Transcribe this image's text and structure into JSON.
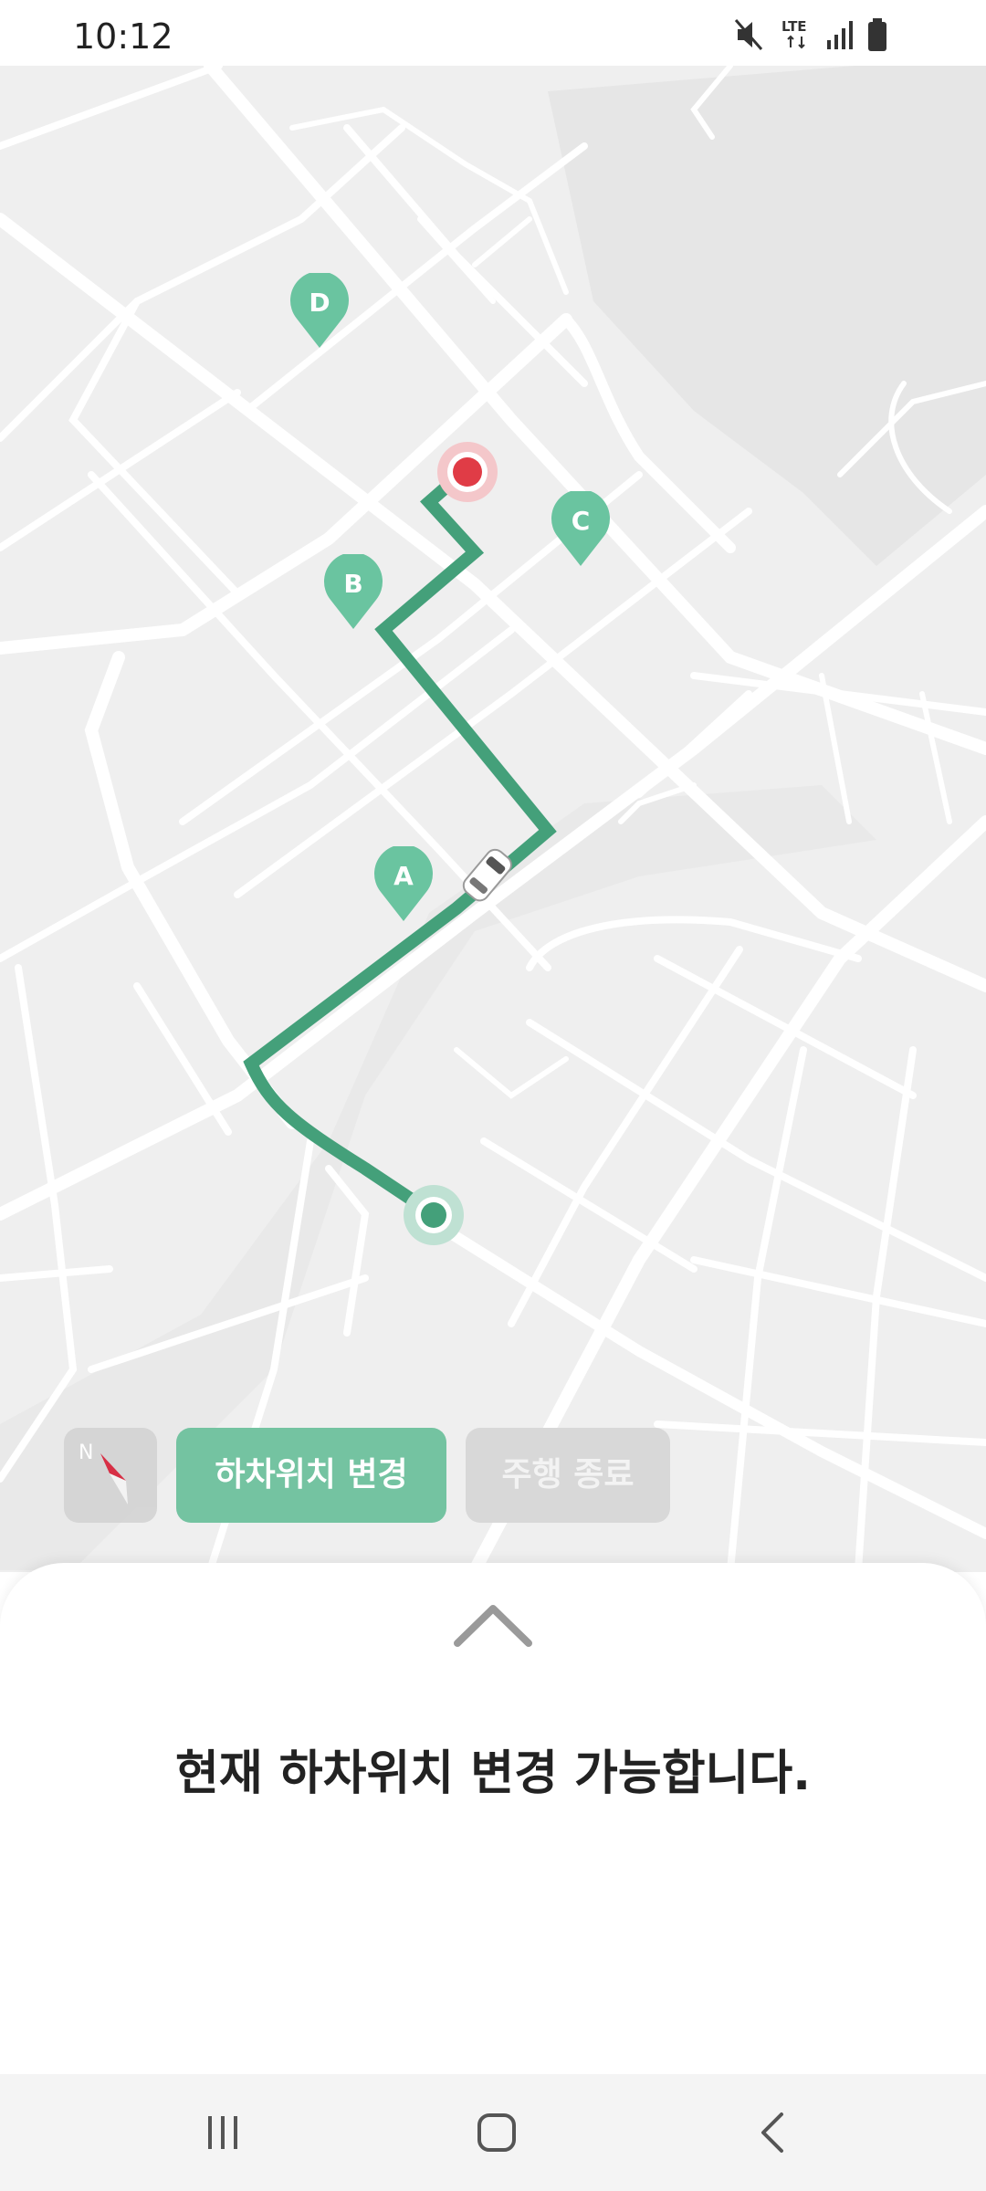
{
  "status_bar": {
    "time": "10:12",
    "icons": [
      "mute-icon",
      "lte-icon",
      "signal-icon",
      "battery-icon"
    ],
    "lte_label": "LTE"
  },
  "map": {
    "markers": [
      {
        "label": "D",
        "type": "waypoint"
      },
      {
        "label": "C",
        "type": "waypoint"
      },
      {
        "label": "B",
        "type": "waypoint"
      },
      {
        "label": "A",
        "type": "waypoint"
      }
    ],
    "colors": {
      "route": "#44a07a",
      "marker": "#6ac4a0",
      "destination": "#e03c46",
      "road": "#ffffff",
      "block": "#efefef"
    }
  },
  "controls": {
    "compass_label": "N",
    "change_dropoff": "하차위치 변경",
    "end_drive": "주행 종료"
  },
  "sheet": {
    "message": "현재 하차위치 변경 가능합니다."
  },
  "navbar": {
    "icons": [
      "recent-apps-icon",
      "home-icon",
      "back-icon"
    ]
  }
}
